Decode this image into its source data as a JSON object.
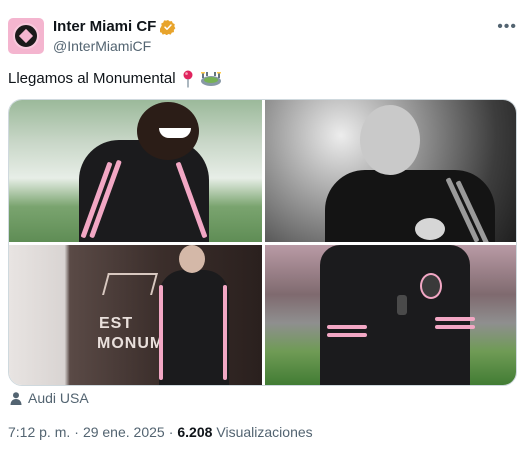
{
  "account": {
    "display_name": "Inter Miami CF",
    "handle": "@InterMiamiCF",
    "verified_color": "#e8a42c"
  },
  "tweet": {
    "text": "Llegamos al Monumental",
    "emojis": [
      "round-pushpin-icon",
      "stadium-icon"
    ]
  },
  "media": {
    "photos": [
      {
        "name": "photo-player-smiling"
      },
      {
        "name": "photo-player-profile-bw"
      },
      {
        "name": "photo-player-tunnel"
      },
      {
        "name": "photo-player-pitch"
      }
    ],
    "tunnel_sign": "ESTADIO MONUMENTAL",
    "tunnel_sign_visible": [
      "EST",
      "MONUM"
    ]
  },
  "sponsor": {
    "label": "Audi USA"
  },
  "footer": {
    "time": "7:12 p. m.",
    "separator": "·",
    "date": "29 ene. 2025",
    "views_count": "6.208",
    "views_label": "Visualizaciones"
  },
  "colors": {
    "brand_pink": "#f2a7c4",
    "text_secondary": "#536471"
  }
}
